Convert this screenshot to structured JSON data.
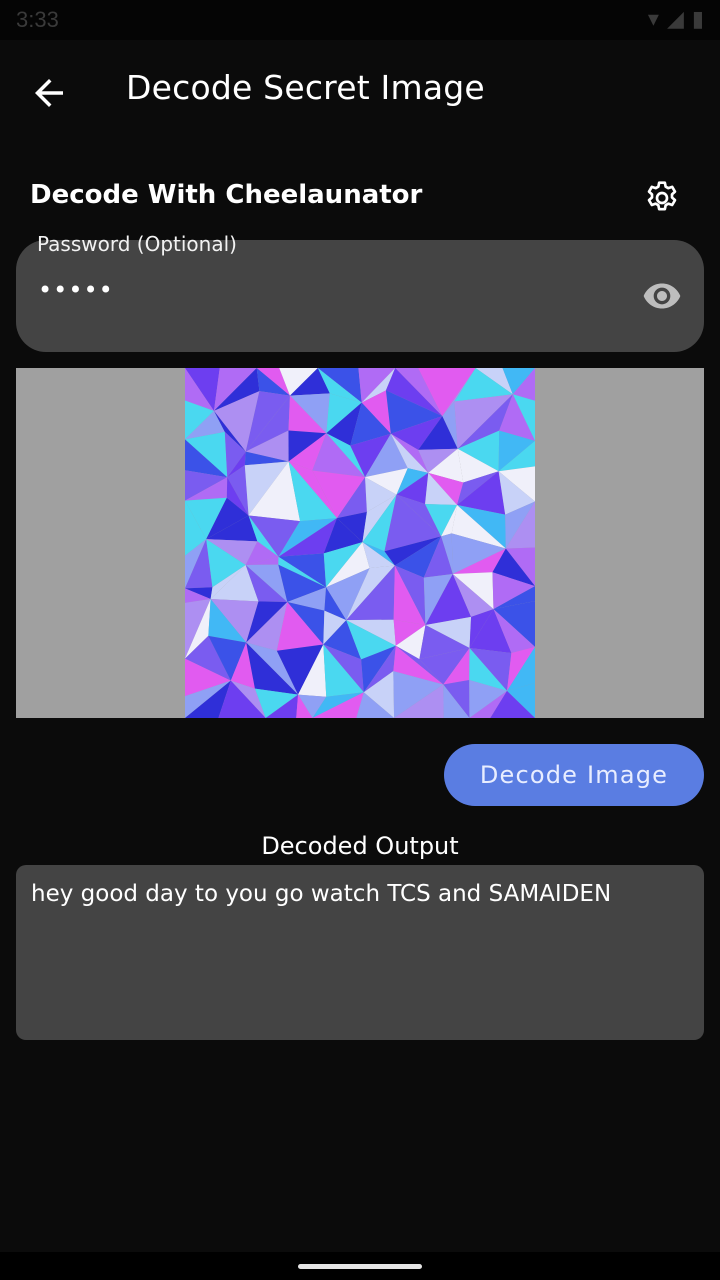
{
  "status_bar": {
    "time": "3:33"
  },
  "app_bar": {
    "title": "Decode Secret Image",
    "back_icon": "arrow-left-icon"
  },
  "section": {
    "title": "Decode With Cheelaunator",
    "settings_icon": "gear-icon"
  },
  "password": {
    "label": "Password (Optional)",
    "value": "•••••",
    "visibility_icon": "eye-icon"
  },
  "image_preview": {
    "background_color": "#a0a0a0",
    "palette": [
      "#3b52e8",
      "#7a5cf0",
      "#b06bf5",
      "#e15bf0",
      "#4ad8f0",
      "#8fa0f5",
      "#2f2fd8",
      "#c8d2f8",
      "#6d3ef0",
      "#41b8f5",
      "#ad8ff2",
      "#f0f0fa"
    ]
  },
  "decode_button": {
    "label": "Decode Image",
    "color": "#5a7de2"
  },
  "output": {
    "label": "Decoded Output",
    "text": "hey good day to you go watch TCS and SAMAIDEN"
  }
}
